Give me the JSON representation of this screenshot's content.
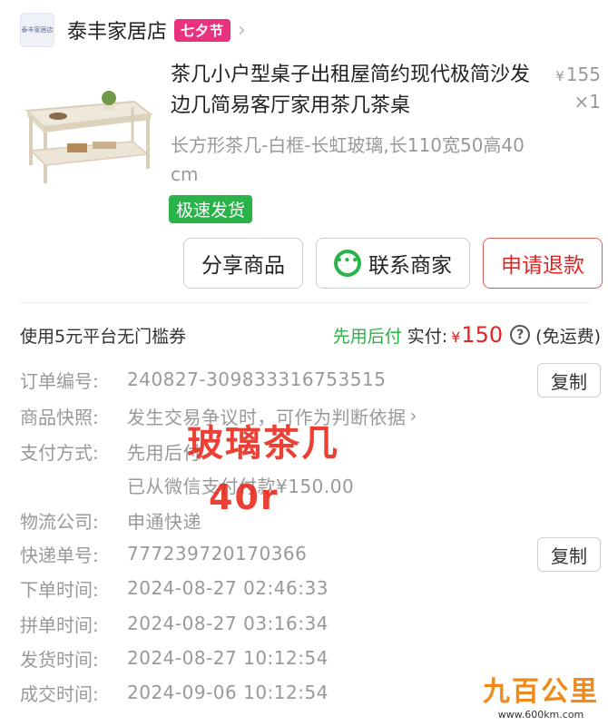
{
  "shop": {
    "logo_text": "泰丰家居店",
    "name": "泰丰家居店",
    "badge": "七夕节"
  },
  "product": {
    "title": "茶几小户型桌子出租屋简约现代极简沙发边几简易客厅家用茶几茶桌",
    "price_symbol": "¥",
    "price": "155",
    "quantity": "×1",
    "spec": "长方形茶几-白框-长虹玻璃,长110宽50高40cm",
    "fast_ship_badge": "极速发货"
  },
  "actions": {
    "share": "分享商品",
    "contact": "联系商家",
    "refund": "申请退款"
  },
  "summary": {
    "coupon": "使用5元平台无门槛券",
    "pay_later": "先用后付",
    "paid_label": "实付:",
    "paid_symbol": "¥",
    "paid_amount": "150",
    "help": "?",
    "shipping_note": "(免运费)"
  },
  "order_info": {
    "order_no_label": "订单编号:",
    "order_no": "240827-309833316753515",
    "copy_label": "复制",
    "snapshot_label": "商品快照:",
    "snapshot_value": "发生交易争议时，可作为判断依据",
    "payment_label": "支付方式:",
    "payment_value": "先用后付",
    "payment_detail": "已从微信支付付款¥150.00",
    "logistics_label": "物流公司:",
    "logistics_value": "申通快递",
    "tracking_label": "快递单号:",
    "tracking_no": "777239720170366",
    "order_time_label": "下单时间:",
    "order_time": "2024-08-27 02:46:33",
    "group_time_label": "拼单时间:",
    "group_time": "2024-08-27 03:16:34",
    "ship_time_label": "发货时间:",
    "ship_time": "2024-08-27 10:12:54",
    "deal_time_label": "成交时间:",
    "deal_time": "2024-09-06 10:12:54"
  },
  "overlay": {
    "line1": "玻璃茶几",
    "line2": "40r"
  },
  "watermark": {
    "main": "九百公里",
    "url": "www.600km.com"
  },
  "colors": {
    "accent_red": "#e02424",
    "pay_green": "#2ab348",
    "festival_pink": "#e8317f"
  }
}
